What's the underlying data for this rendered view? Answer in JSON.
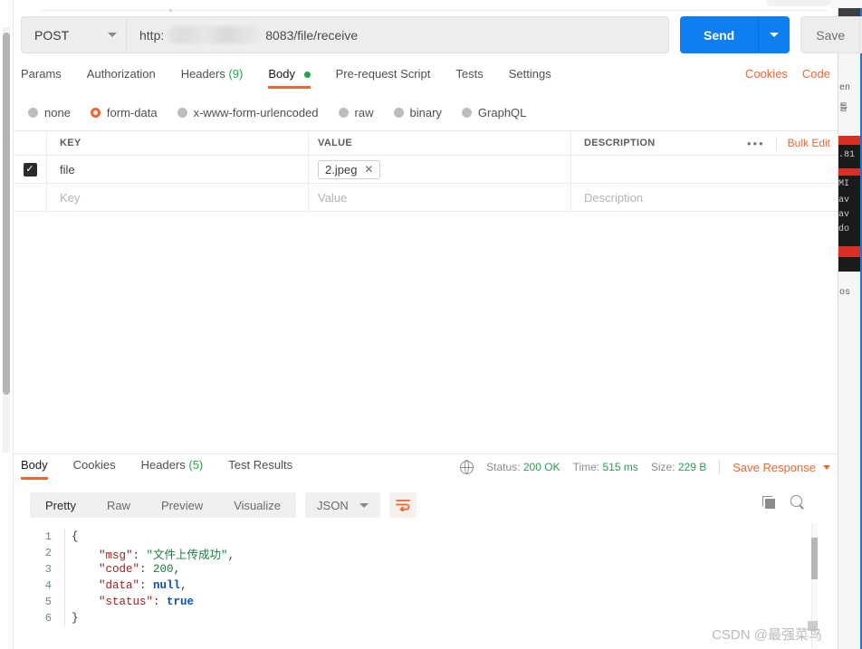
{
  "request": {
    "method": "POST",
    "url_prefix": "http:",
    "url_suffix": "8083/file/receive",
    "send_label": "Send",
    "save_label": "Save",
    "tabs": [
      {
        "label": "Params",
        "count": "",
        "active": false,
        "dot": false
      },
      {
        "label": "Authorization",
        "count": "",
        "active": false,
        "dot": false
      },
      {
        "label": "Headers",
        "count": "(9)",
        "active": false,
        "dot": false
      },
      {
        "label": "Body",
        "count": "",
        "active": true,
        "dot": true
      },
      {
        "label": "Pre-request Script",
        "count": "",
        "active": false,
        "dot": false
      },
      {
        "label": "Tests",
        "count": "",
        "active": false,
        "dot": false
      },
      {
        "label": "Settings",
        "count": "",
        "active": false,
        "dot": false
      }
    ],
    "tab_links": [
      {
        "label": "Cookies"
      },
      {
        "label": "Code"
      }
    ],
    "body_types": [
      {
        "label": "none",
        "selected": false
      },
      {
        "label": "form-data",
        "selected": true
      },
      {
        "label": "x-www-form-urlencoded",
        "selected": false
      },
      {
        "label": "raw",
        "selected": false
      },
      {
        "label": "binary",
        "selected": false
      },
      {
        "label": "GraphQL",
        "selected": false
      }
    ],
    "table": {
      "headers": {
        "key": "KEY",
        "value": "VALUE",
        "description": "DESCRIPTION"
      },
      "dots_label": "•••",
      "bulk_edit_label": "Bulk Edit",
      "rows": [
        {
          "checked": true,
          "key": "file",
          "value": "2.jpeg",
          "value_is_file": true,
          "description": ""
        }
      ],
      "placeholder_row": {
        "key": "Key",
        "value": "Value",
        "description": "Description"
      }
    }
  },
  "response": {
    "tabs": [
      {
        "label": "Body",
        "count": "",
        "active": true
      },
      {
        "label": "Cookies",
        "count": "",
        "active": false
      },
      {
        "label": "Headers",
        "count": "(5)",
        "active": false
      },
      {
        "label": "Test Results",
        "count": "",
        "active": false
      }
    ],
    "meta": {
      "status_label": "Status:",
      "status_value": "200 OK",
      "time_label": "Time:",
      "time_value": "515 ms",
      "size_label": "Size:",
      "size_value": "229 B",
      "save_response_label": "Save Response"
    },
    "view_modes": [
      {
        "label": "Pretty",
        "active": true
      },
      {
        "label": "Raw",
        "active": false
      },
      {
        "label": "Preview",
        "active": false
      },
      {
        "label": "Visualize",
        "active": false
      }
    ],
    "format": "JSON",
    "body_lines": [
      {
        "num": "1",
        "segments": [
          {
            "text": "{",
            "cls": "k-brace"
          }
        ]
      },
      {
        "num": "2",
        "segments": [
          {
            "text": "    ",
            "cls": "k-punc"
          },
          {
            "text": "\"msg\"",
            "cls": "k-key"
          },
          {
            "text": ": ",
            "cls": "k-punc"
          },
          {
            "text": "\"文件上传成功\"",
            "cls": "k-str"
          },
          {
            "text": ",",
            "cls": "k-punc"
          }
        ]
      },
      {
        "num": "3",
        "segments": [
          {
            "text": "    ",
            "cls": "k-punc"
          },
          {
            "text": "\"code\"",
            "cls": "k-key"
          },
          {
            "text": ": ",
            "cls": "k-punc"
          },
          {
            "text": "200",
            "cls": "k-num"
          },
          {
            "text": ",",
            "cls": "k-punc"
          }
        ]
      },
      {
        "num": "4",
        "segments": [
          {
            "text": "    ",
            "cls": "k-punc"
          },
          {
            "text": "\"data\"",
            "cls": "k-key"
          },
          {
            "text": ": ",
            "cls": "k-punc"
          },
          {
            "text": "null",
            "cls": "k-lit"
          },
          {
            "text": ",",
            "cls": "k-punc"
          }
        ]
      },
      {
        "num": "5",
        "segments": [
          {
            "text": "    ",
            "cls": "k-punc"
          },
          {
            "text": "\"status\"",
            "cls": "k-key"
          },
          {
            "text": ": ",
            "cls": "k-punc"
          },
          {
            "text": "true",
            "cls": "k-lit"
          }
        ]
      },
      {
        "num": "6",
        "segments": [
          {
            "text": "}",
            "cls": "k-brace"
          }
        ]
      }
    ]
  },
  "background_window": {
    "fragments": [
      "en",
      "틀",
      ".81",
      "MI",
      "av",
      "av",
      "do",
      "os"
    ]
  },
  "watermark": "CSDN @最强菜鸟",
  "colors": {
    "accent_orange": "#ef6631",
    "send_blue": "#0d7ff1",
    "status_green": "#2d9d4f"
  }
}
